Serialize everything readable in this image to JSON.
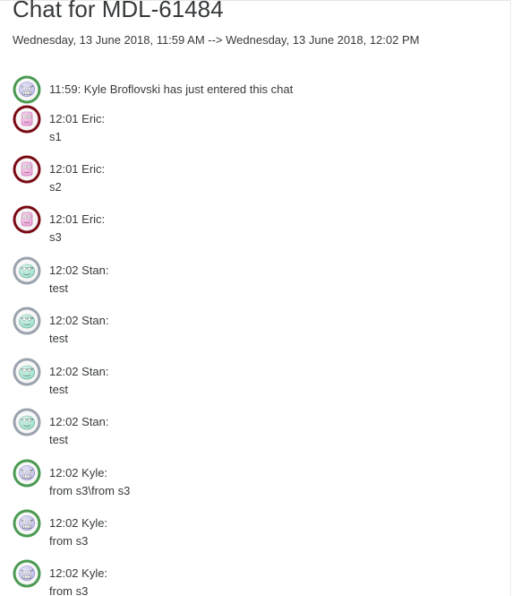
{
  "header": {
    "title": "Chat for MDL-61484",
    "date_range": "Wednesday, 13 June 2018, 11:59 AM --> Wednesday, 13 June 2018, 12:02 PM"
  },
  "messages": [
    {
      "type": "system",
      "avatar": "kyle-avatar-icon",
      "line": "11:59: Kyle Broflovski has just entered this chat"
    },
    {
      "type": "user",
      "avatar": "eric-avatar-icon",
      "meta": "12:01 Eric:",
      "text": "s1"
    },
    {
      "type": "user",
      "avatar": "eric-avatar-icon",
      "meta": "12:01 Eric:",
      "text": "s2"
    },
    {
      "type": "user",
      "avatar": "eric-avatar-icon",
      "meta": "12:01 Eric:",
      "text": "s3"
    },
    {
      "type": "user",
      "avatar": "stan-avatar-icon",
      "meta": "12:02 Stan:",
      "text": "test"
    },
    {
      "type": "user",
      "avatar": "stan-avatar-icon",
      "meta": "12:02 Stan:",
      "text": "test"
    },
    {
      "type": "user",
      "avatar": "stan-avatar-icon",
      "meta": "12:02 Stan:",
      "text": "test"
    },
    {
      "type": "user",
      "avatar": "stan-avatar-icon",
      "meta": "12:02 Stan:",
      "text": "test"
    },
    {
      "type": "user",
      "avatar": "kyle-avatar-icon",
      "meta": "12:02 Kyle:",
      "text": "from s3\\from s3"
    },
    {
      "type": "user",
      "avatar": "kyle-avatar-icon",
      "meta": "12:02 Kyle:",
      "text": "from s3"
    },
    {
      "type": "user",
      "avatar": "kyle-avatar-icon",
      "meta": "12:02 Kyle:",
      "text": "from s3"
    }
  ],
  "colors": {
    "eric_ring": "#7a0a14",
    "eric_face": "#e88fd0",
    "stan_ring": "#9aa3ad",
    "stan_face": "#8fdcc4",
    "kyle_ring": "#4a9a52",
    "kyle_face": "#b6b4e6"
  }
}
